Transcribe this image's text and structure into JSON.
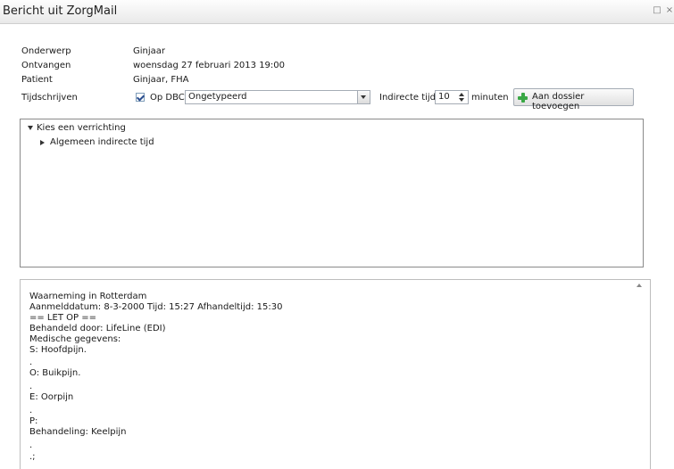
{
  "window": {
    "title": "Bericht uit ZorgMail",
    "minimize_glyph": "□",
    "close_glyph": "×"
  },
  "fields": {
    "onderwerp_label": "Onderwerp",
    "onderwerp_value": "Ginjaar",
    "ontvangen_label": "Ontvangen",
    "ontvangen_value": "woensdag 27 februari 2013 19:00",
    "patient_label": "Patient",
    "patient_value": "Ginjaar, FHA",
    "tijdschrijven_label": "Tijdschrijven"
  },
  "tijdschrijven": {
    "checkbox_checked": true,
    "checkbox_label": "Op DBC",
    "select_value": "Ongetypeerd",
    "indirect_label": "Indirecte tijd",
    "indirect_value": "10",
    "unit_label": "minuten",
    "add_button_label": "Aan dossier toevoegen",
    "add_button_icon": "plus-icon"
  },
  "tree": {
    "root_label": "Kies een verrichting",
    "child_label": "Algemeen indirecte tijd"
  },
  "message": {
    "lines": [
      "Waarneming in Rotterdam",
      "Aanmelddatum: 8-3-2000 Tijd: 15:27 Afhandeltijd: 15:30",
      "== LET OP ==",
      "Behandeld door: LifeLine (EDI)",
      "Medische gegevens:",
      "S: Hoofdpijn.",
      ".",
      "O: Buikpijn.",
      ".",
      "E: Oorpijn",
      ".",
      "P:",
      "Behandeling: Keelpijn",
      ".",
      ".;"
    ]
  }
}
